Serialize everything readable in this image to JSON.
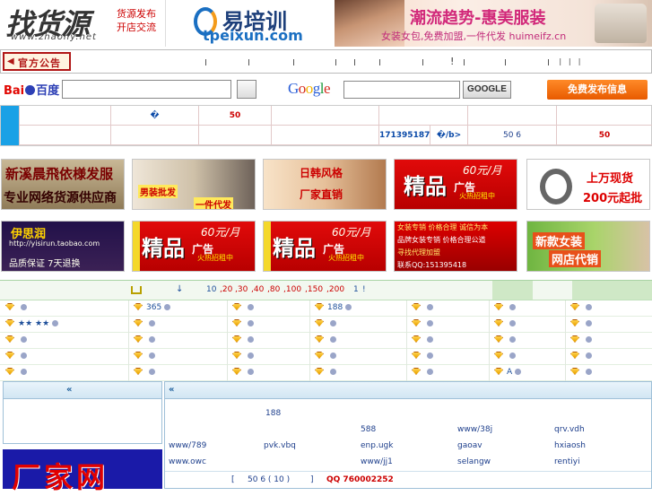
{
  "header": {
    "logo": {
      "title": "找货源",
      "slogan_line1": "货源发布",
      "slogan_line2": "开店交流",
      "url": "www.zhaohy.net"
    },
    "peixun": {
      "title": "易培训",
      "url": "tpeixun.com"
    },
    "fashion": {
      "title": "潮流趋势-惠美服装",
      "subtitle": "女装女包,免费加盟,一件代发  huimeifz.cn"
    }
  },
  "notice": {
    "label": "官方公告",
    "excl": "!",
    "bars": "I I I"
  },
  "search": {
    "baidu_logo_left": "Bai",
    "baidu_logo_right": "百度",
    "google_logo": "Google",
    "google_button": "GOOGLE",
    "publish_button": "免费发布信息"
  },
  "info_table": {
    "row1": {
      "mark": "�",
      "count": "50"
    },
    "row2": {
      "qq": "171395187�",
      "tag": "�/b>",
      "count_a": "50 6",
      "count_b": "50"
    }
  },
  "ads": {
    "row1": [
      {
        "text": "新溪晨飛依様发服",
        "sub": "专业网络货源供应商"
      },
      {
        "text": "男装批发",
        "sub": "一件代发"
      },
      {
        "text": "日韩风格",
        "sub": "厂家直销"
      },
      {
        "big": "精品",
        "word": "广告",
        "price": "60元/月",
        "small": "火热招租中"
      },
      {
        "text": "上万现货",
        "sub": "200元起批"
      }
    ],
    "row2": [
      {
        "text": "伊思润",
        "sub": "品质保证 7天退换",
        "url": "http://yisirun.taobao.com"
      },
      {
        "big": "精品",
        "word": "广告",
        "price": "60元/月",
        "small": "火热招租中"
      },
      {
        "big": "精品",
        "word": "广告",
        "price": "60元/月",
        "small": "火热招租中"
      },
      {
        "text": "女装专销  价格合理  诚信为本",
        "line2": "品牌女装专销 价格合理公道",
        "line3": "寻找代理加盟",
        "line4": "联系QQ:151395418"
      },
      {
        "text": "新款女装",
        "sub": "网店代销"
      }
    ]
  },
  "categories": {
    "head_items": [
      "↓",
      "10",
      ",20",
      ",30",
      ",40",
      ",80",
      ",100",
      ",150",
      ",200",
      "1",
      "!"
    ],
    "rows": [
      [
        "",
        "365",
        "",
        "188",
        "",
        "",
        ""
      ],
      [
        "★★ ★★",
        "",
        "",
        "",
        "",
        "",
        ""
      ],
      [
        "",
        "",
        "",
        "",
        "",
        "",
        ""
      ],
      [
        "",
        "",
        "",
        "",
        "",
        "",
        ""
      ],
      [
        "",
        "",
        "",
        "",
        "",
        "A",
        ""
      ]
    ]
  },
  "bottom": {
    "right": {
      "num": "188",
      "links_row1": [
        "588",
        "www/38j",
        "qrv.vdh"
      ],
      "links_row2": [
        "www/789",
        "pvk.vbq",
        "enp.ugk",
        "gaoav",
        "hxiaosh"
      ],
      "links_row3": [
        "www.owc",
        "www/jj1",
        "selangw",
        "rentiyi"
      ],
      "footer_bracket": "[",
      "footer_count": "50 6 ( 10 )",
      "footer_close": "]",
      "footer_qq": "QQ 760002252"
    },
    "factory_ad": "厂家网"
  }
}
